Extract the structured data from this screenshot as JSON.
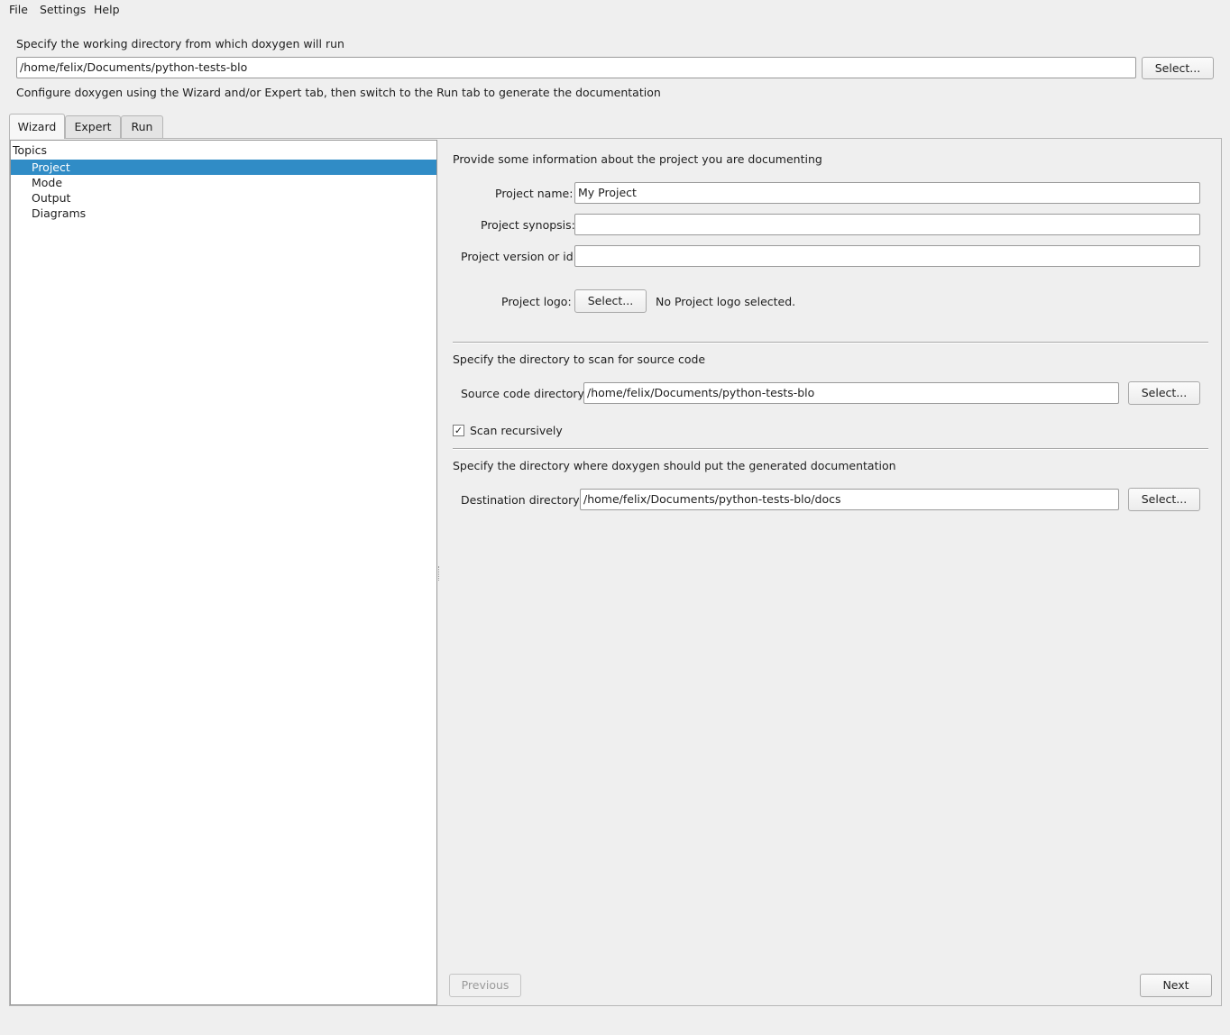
{
  "menubar": {
    "items": [
      "File",
      "Settings",
      "Help"
    ]
  },
  "workdir": {
    "prompt": "Specify the working directory from which doxygen will run",
    "value": "/home/felix/Documents/python-tests-blo",
    "select_label": "Select...",
    "hint": "Configure doxygen using the Wizard and/or Expert tab, then switch to the Run tab to generate the documentation"
  },
  "tabs": [
    "Wizard",
    "Expert",
    "Run"
  ],
  "topics": {
    "header": "Topics",
    "items": [
      "Project",
      "Mode",
      "Output",
      "Diagrams"
    ],
    "selected": "Project"
  },
  "project": {
    "intro": "Provide some information about the project you are documenting",
    "name_label": "Project name:",
    "name_value": "My Project",
    "synopsis_label": "Project synopsis:",
    "synopsis_value": "",
    "version_label": "Project version or id:",
    "version_value": "",
    "logo_label": "Project logo:",
    "logo_select_label": "Select...",
    "logo_status": "No Project logo selected."
  },
  "source": {
    "intro": "Specify the directory to scan for source code",
    "dir_label": "Source code directory:",
    "dir_value": "/home/felix/Documents/python-tests-blo",
    "select_label": "Select...",
    "recursive_label": "Scan recursively",
    "recursive_checked": true
  },
  "destination": {
    "intro": "Specify the directory where doxygen should put the generated documentation",
    "dir_label": "Destination directory:",
    "dir_value": "/home/felix/Documents/python-tests-blo/docs",
    "select_label": "Select..."
  },
  "nav": {
    "previous_label": "Previous",
    "next_label": "Next"
  },
  "colors": {
    "selection": "#308cc6",
    "window_bg": "#efefef"
  }
}
